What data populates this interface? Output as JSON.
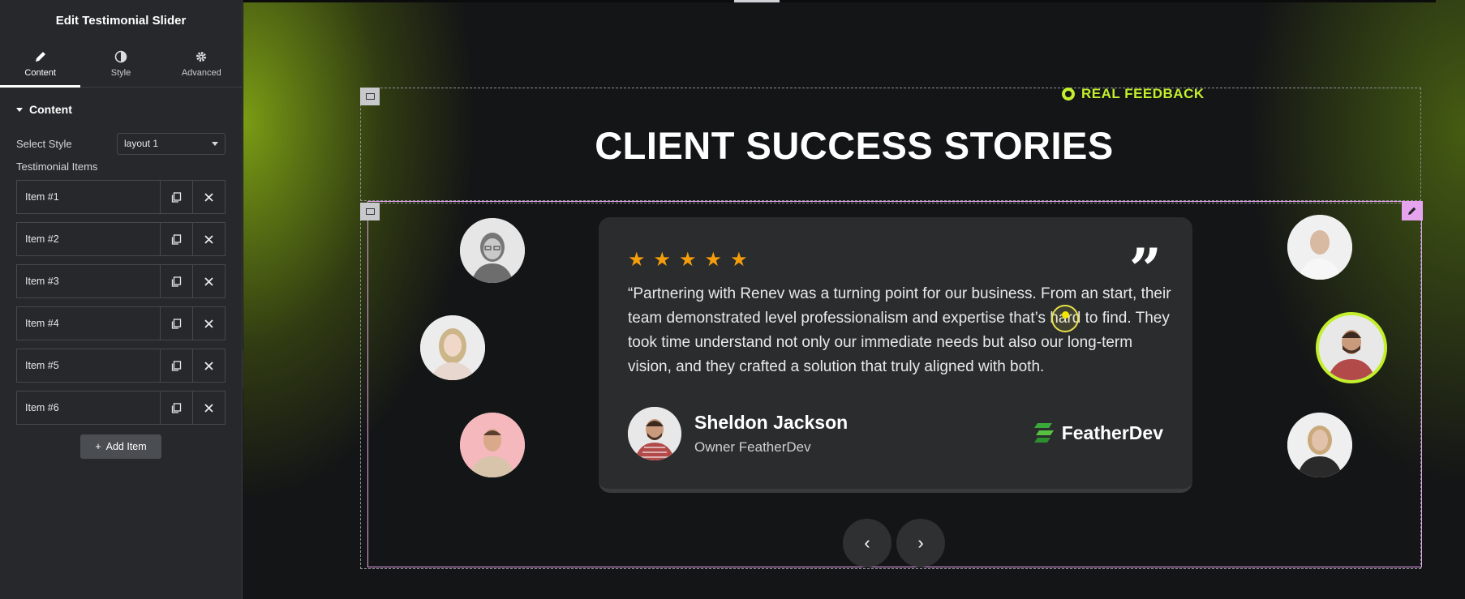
{
  "panel": {
    "title": "Edit Testimonial Slider",
    "tabs": [
      {
        "label": "Content",
        "icon": "pencil-icon"
      },
      {
        "label": "Style",
        "icon": "half-circle-icon"
      },
      {
        "label": "Advanced",
        "icon": "gear-icon"
      }
    ],
    "section_label": "Content",
    "select_style_label": "Select Style",
    "select_style_value": "layout 1",
    "items_label": "Testimonial Items",
    "items": [
      "Item #1",
      "Item #2",
      "Item #3",
      "Item #4",
      "Item #5",
      "Item #6"
    ],
    "add_item_label": "Add Item"
  },
  "hero": {
    "eyebrow": "REAL FEEDBACK",
    "title": "CLIENT SUCCESS STORIES",
    "accent_color": "#c3ef2c"
  },
  "testimonial": {
    "rating": 5,
    "quote_mark": "”",
    "text": "“Partnering with Renev was a turning point for our business. From an start, their team demonstrated level professionalism and expertise that’s hard to find. They took time understand not only our immediate needs but also our long-term vision, and they crafted a solution that truly aligned with both.",
    "author_name": "Sheldon Jackson",
    "author_role": "Owner FeatherDev",
    "brand": "FeatherDev",
    "star_color": "#f59e0b"
  },
  "nav": {
    "prev": "‹",
    "next": "›"
  }
}
